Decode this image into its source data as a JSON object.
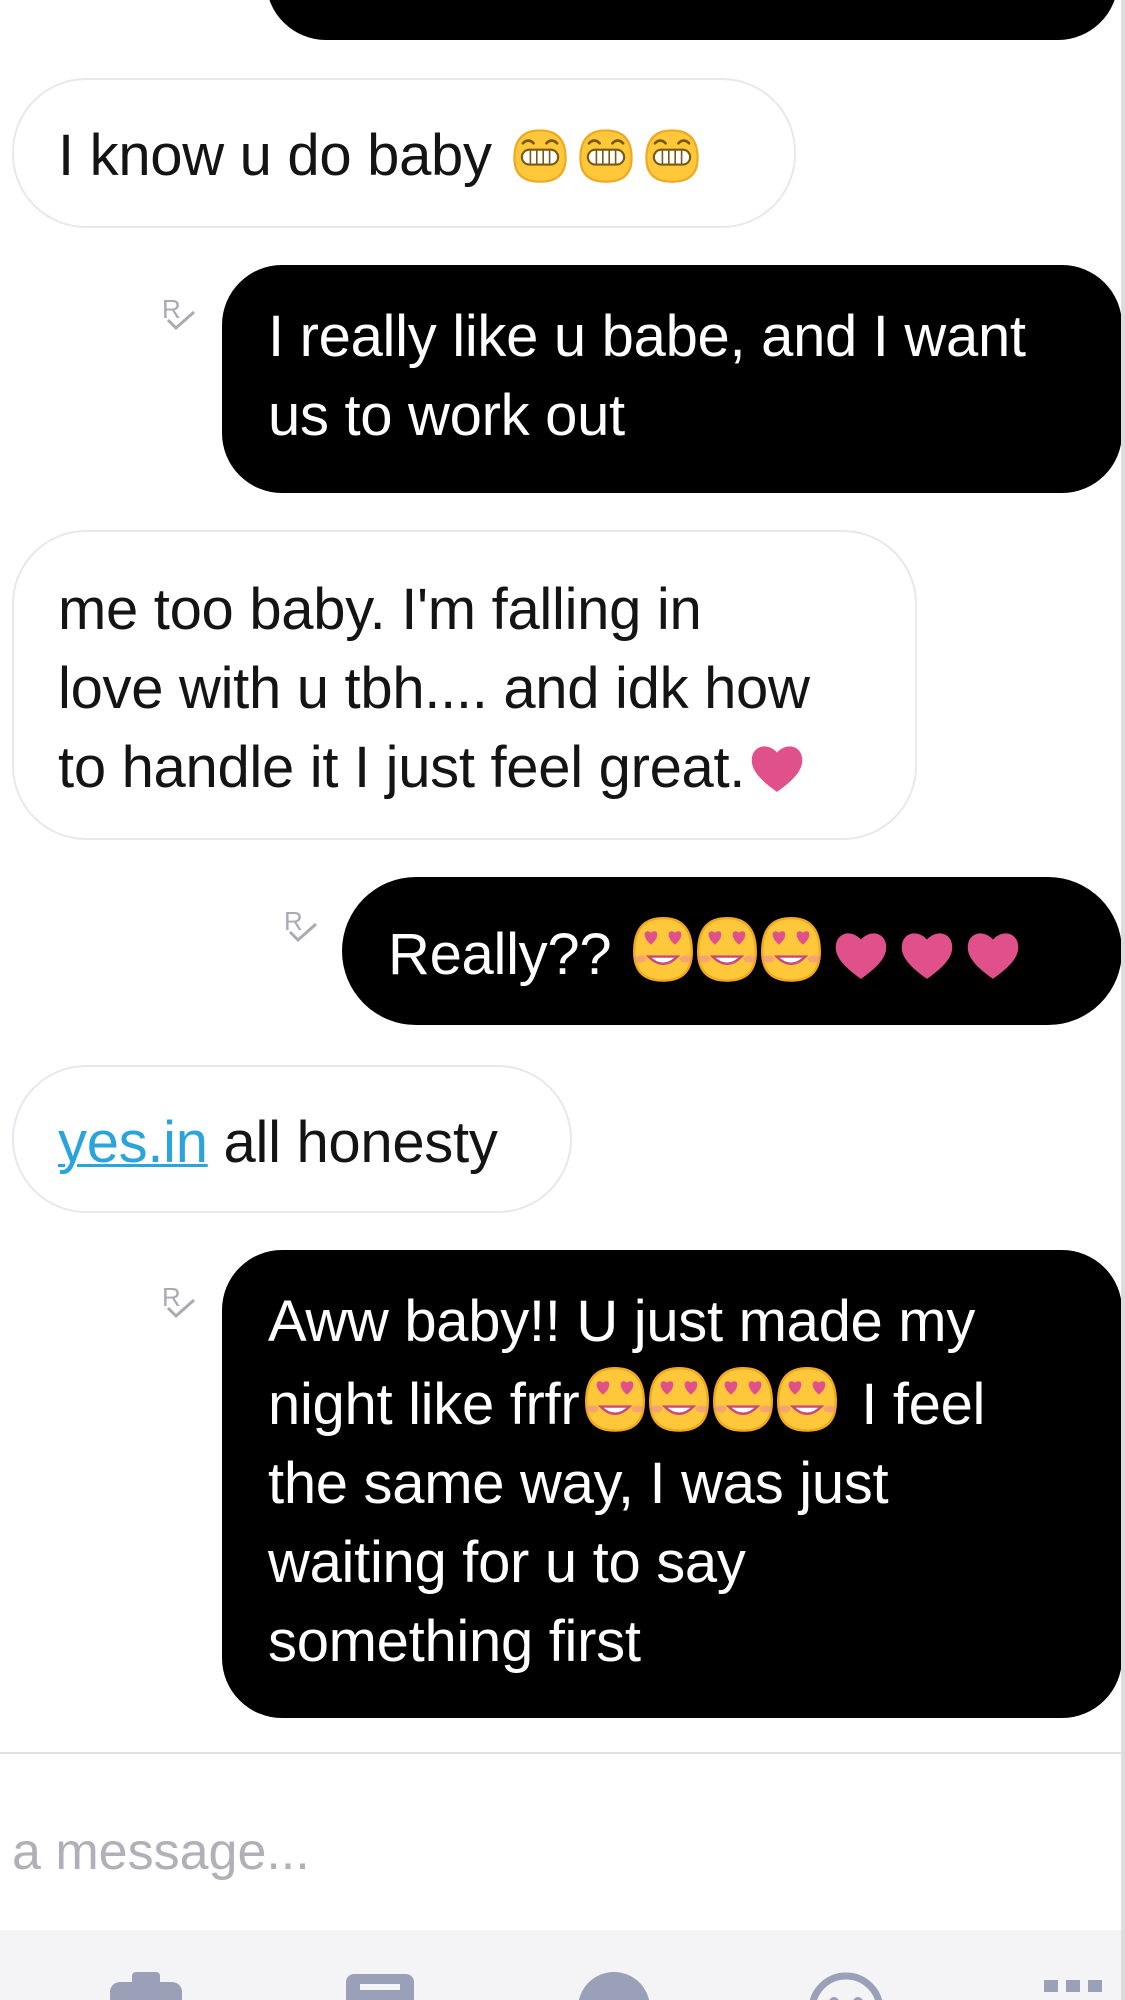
{
  "thread": {
    "messages": [
      {
        "direction": "incoming",
        "text": "I know u do baby",
        "emojis": [
          "grin-emoji",
          "grin-emoji",
          "grin-emoji"
        ]
      },
      {
        "direction": "outgoing",
        "read_receipt": "R",
        "lines": [
          "I really like u babe, and I want",
          "us to work out"
        ]
      },
      {
        "direction": "incoming",
        "lines": [
          "me too baby.  I'm falling in",
          "love with u tbh.... and idk how",
          "to handle it I just feel great."
        ],
        "emojis": [
          "heart-emoji"
        ]
      },
      {
        "direction": "outgoing",
        "read_receipt": "R",
        "text": "Really??",
        "emojis": [
          "heart-eyes-emoji",
          "heart-eyes-emoji",
          "heart-eyes-emoji",
          "heart-emoji",
          "heart-emoji",
          "heart-emoji"
        ]
      },
      {
        "direction": "incoming",
        "link_text": "yes.in",
        "text": " all honesty"
      },
      {
        "direction": "outgoing",
        "read_receipt": "R",
        "lines": [
          "Aww baby!! U just made my",
          "night like frfr",
          " I feel",
          "the same way, I was just",
          "waiting for u to say",
          "something first"
        ],
        "emojis": [
          "heart-eyes-emoji",
          "heart-eyes-emoji",
          "heart-eyes-emoji",
          "heart-eyes-emoji"
        ]
      }
    ]
  },
  "composer": {
    "placeholder": "a message..."
  },
  "toolbar": {
    "icons": [
      "camera-icon",
      "gif-icon",
      "voice-icon",
      "emoji-icon",
      "more-icon"
    ]
  },
  "colors": {
    "outgoing_bubble": "#000000",
    "incoming_bubble": "#ffffff",
    "incoming_border": "#e7e7ee",
    "link": "#2aa5dc",
    "heart": "#e0508a",
    "emoji_face": "#ffc83a",
    "receipt": "#aaaab4",
    "placeholder": "#b0b0b8"
  }
}
